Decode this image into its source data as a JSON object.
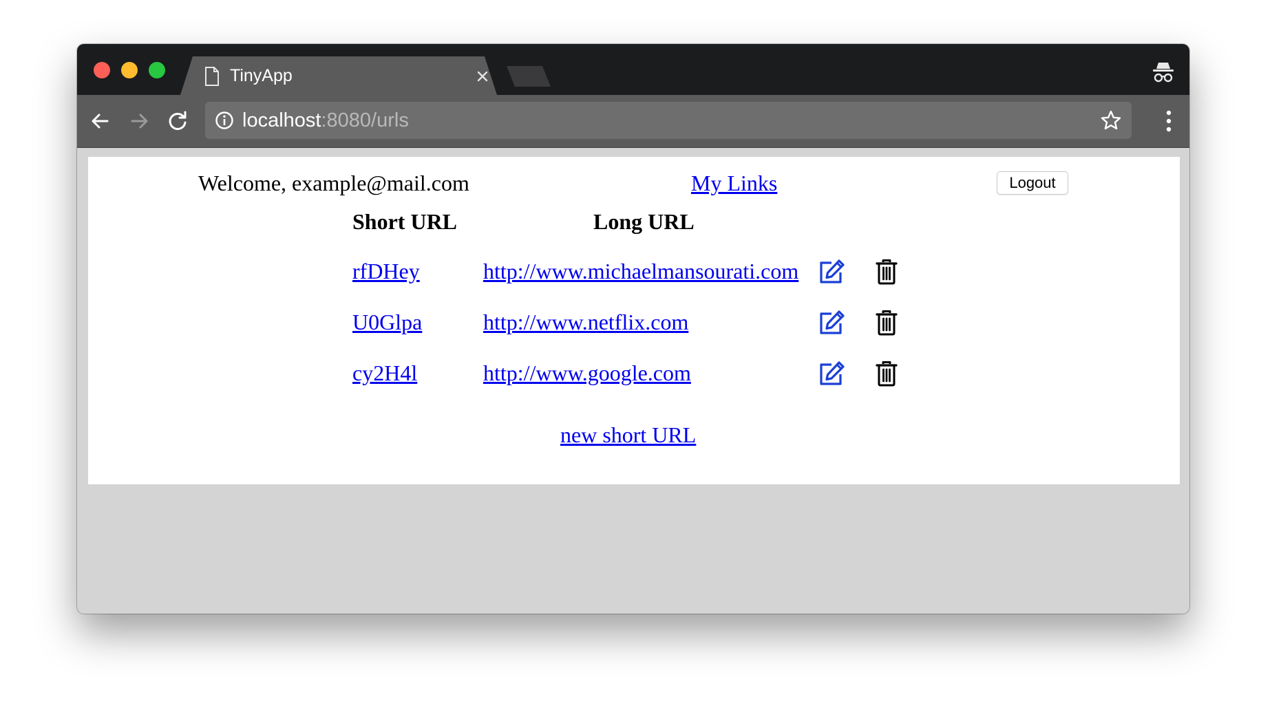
{
  "browser": {
    "tab_title": "TinyApp",
    "url_host": "localhost",
    "url_rest": ":8080/urls",
    "icons": {
      "back": "arrow-left-icon",
      "forward": "arrow-right-icon",
      "reload": "reload-icon",
      "info": "info-icon",
      "bookmark": "star-icon",
      "menu": "kebab-menu-icon",
      "incognito": "incognito-icon",
      "tab": "document-icon",
      "close": "close-icon"
    }
  },
  "header": {
    "welcome": "Welcome, example@mail.com",
    "my_links": "My Links",
    "logout": "Logout"
  },
  "table": {
    "headers": {
      "short": "Short URL",
      "long": "Long URL"
    },
    "rows": [
      {
        "short": "rfDHey",
        "long": "http://www.michaelmansourati.com"
      },
      {
        "short": "U0Glpa",
        "long": "http://www.netflix.com"
      },
      {
        "short": "cy2H4l",
        "long": "http://www.google.com"
      }
    ]
  },
  "footer": {
    "new_url": "new short URL"
  },
  "colors": {
    "link": "#0000ee",
    "edit_icon": "#1a3fd6",
    "tab_strip": "#1b1c1e",
    "toolbar": "#5b5b5b",
    "window_bg": "#d4d4d4"
  }
}
